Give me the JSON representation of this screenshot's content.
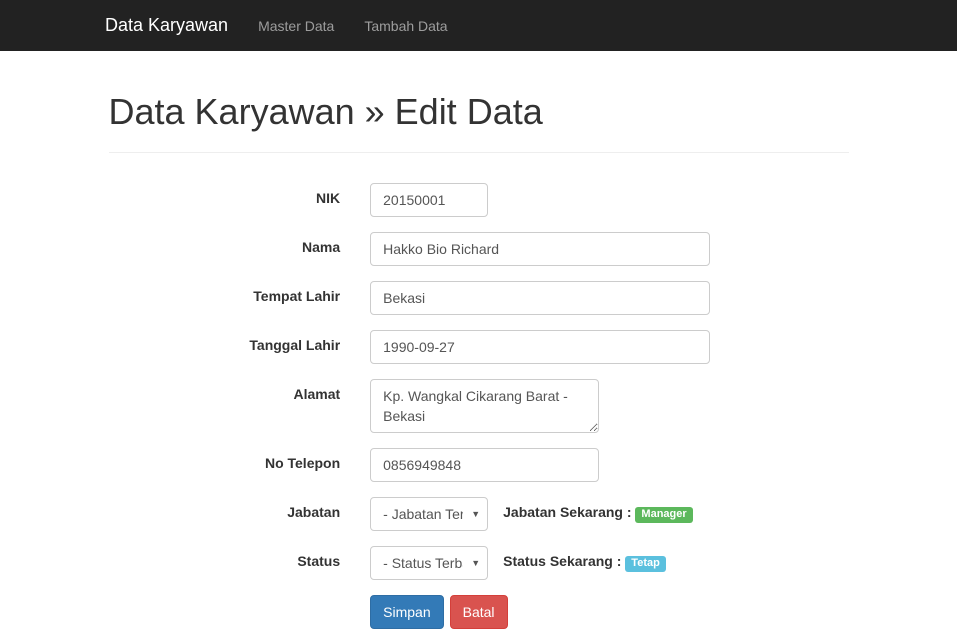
{
  "navbar": {
    "brand": "Data Karyawan",
    "links": [
      "Master Data",
      "Tambah Data"
    ]
  },
  "header": {
    "title": "Data Karyawan » Edit Data"
  },
  "form": {
    "nik": {
      "label": "NIK",
      "value": "20150001"
    },
    "nama": {
      "label": "Nama",
      "value": "Hakko Bio Richard"
    },
    "tempat_lahir": {
      "label": "Tempat Lahir",
      "value": "Bekasi"
    },
    "tanggal_lahir": {
      "label": "Tanggal Lahir",
      "value": "1990-09-27"
    },
    "alamat": {
      "label": "Alamat",
      "value": "Kp. Wangkal Cikarang Barat - Bekasi"
    },
    "no_telepon": {
      "label": "No Telepon",
      "value": "0856949848"
    },
    "jabatan": {
      "label": "Jabatan",
      "selected": "- Jabatan Terbaru -",
      "info_label": "Jabatan Sekarang :",
      "info_value": "Manager"
    },
    "status": {
      "label": "Status",
      "selected": "- Status Terbaru -",
      "info_label": "Status Sekarang :",
      "info_value": "Tetap"
    },
    "buttons": {
      "submit": "Simpan",
      "cancel": "Batal"
    }
  }
}
